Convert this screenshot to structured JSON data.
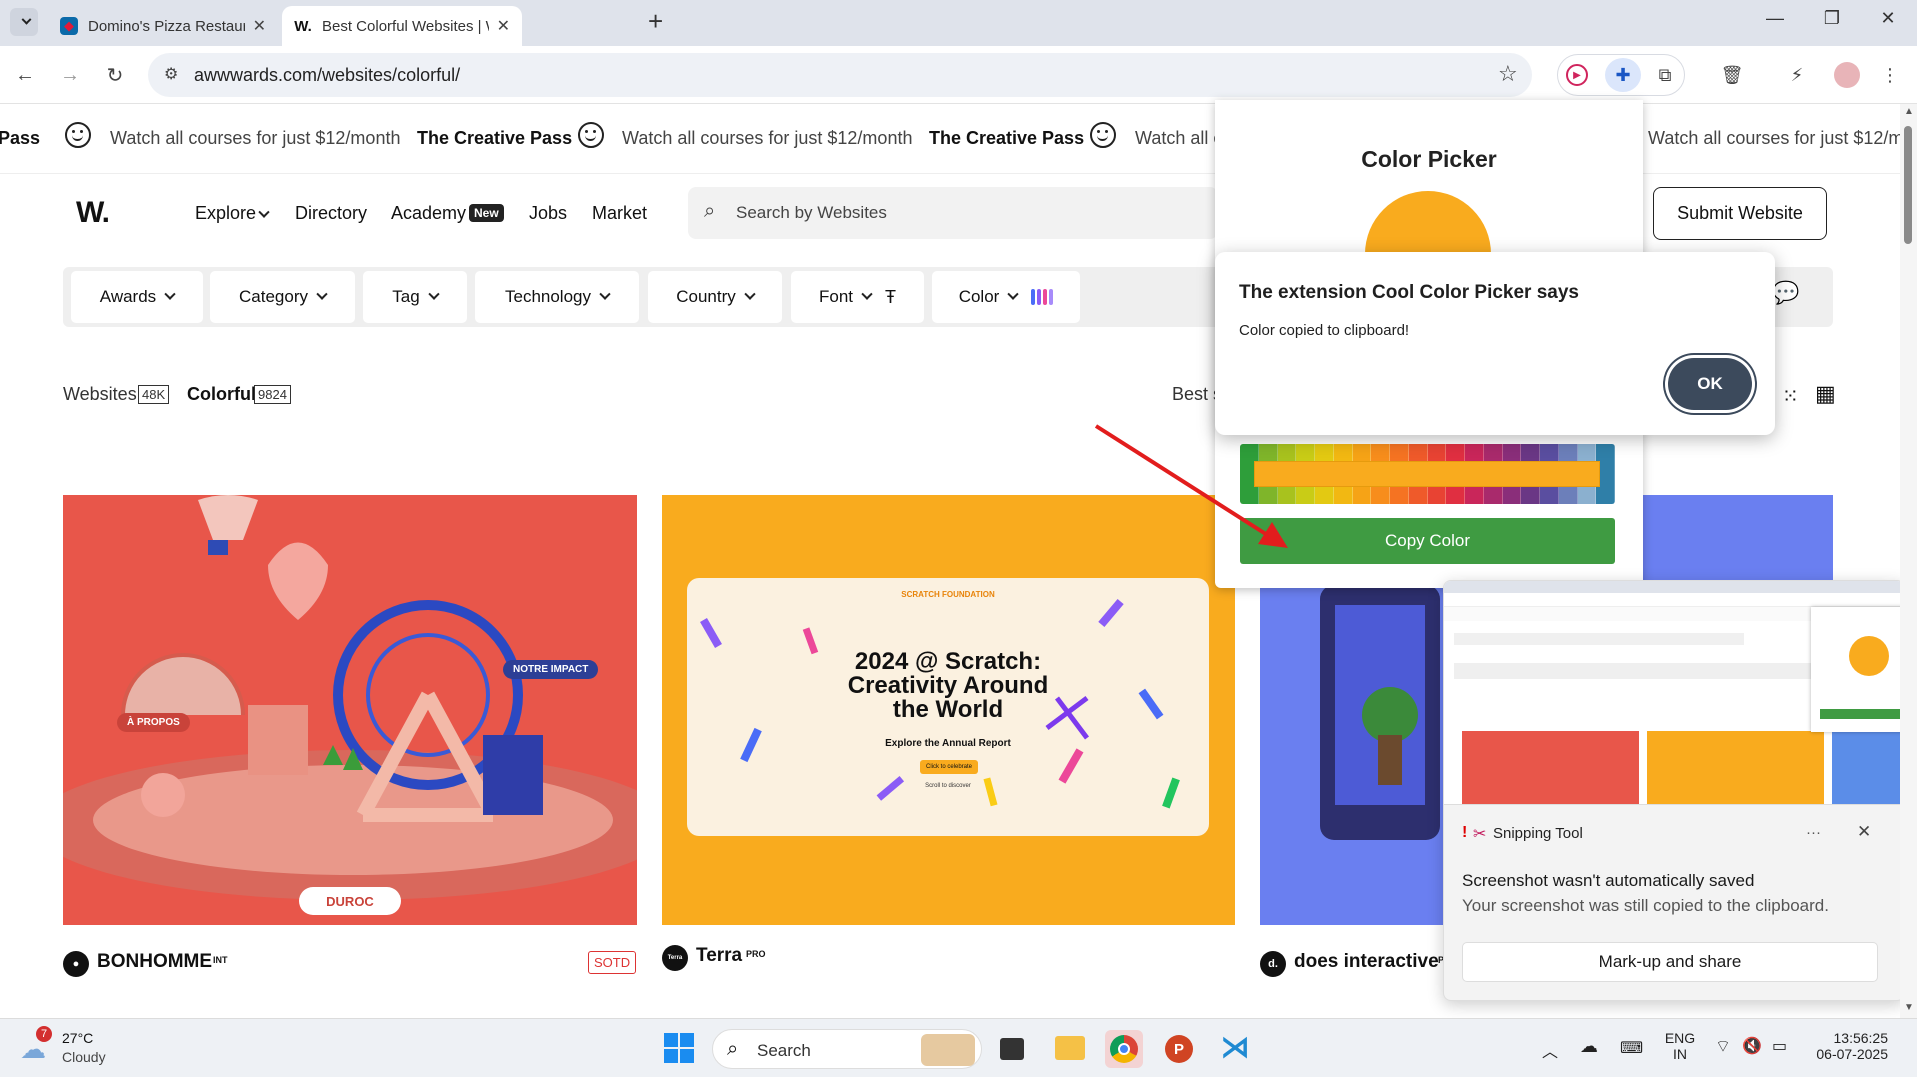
{
  "browser": {
    "tabs": [
      {
        "title": "Domino's Pizza Restaurant Near",
        "active": false
      },
      {
        "title": "Best Colorful Websites | Web De",
        "active": true
      }
    ],
    "new_tab": "+",
    "url": "awwwards.com/websites/colorful/"
  },
  "marquee": {
    "pass": "The Creative Pass",
    "pass_cut": "Pass",
    "offer": "Watch all courses for just $12/month",
    "offer_cut_right": "Watch all courses for just $12/mo",
    "offer_cut_mid": "Watch all c"
  },
  "site": {
    "logo": "W.",
    "nav": [
      "Explore",
      "Directory",
      "Academy",
      "Jobs",
      "Market"
    ],
    "new_badge": "New",
    "search_placeholder": "Search by Websites",
    "submit": "Submit Website"
  },
  "filters": [
    "Awards",
    "Category",
    "Tag",
    "Technology",
    "Country",
    "Font",
    "Color"
  ],
  "counts": {
    "websites_label": "Websites",
    "websites_count": "48K",
    "colorful_label": "Colorful",
    "colorful_count": "9824",
    "sort_cut": "Best s"
  },
  "cards": [
    {
      "name": "BONHOMME",
      "sup": "INT",
      "badge": "SOTD",
      "avatar": "●",
      "labels": [
        "À PROPOS",
        "NOTRE IMPACT"
      ],
      "pill": "DUROC"
    },
    {
      "name": "Terra",
      "sup": "PRO",
      "avatar": "Terra",
      "headline": "2024 @ Scratch: Creativity Around the World",
      "sub": "Explore the Annual Report",
      "brand": "SCRATCH FOUNDATION",
      "cta": "Click to celebrate",
      "hint": "Scroll to discover"
    },
    {
      "name": "does interactive",
      "sup": "PRO",
      "avatar": "d."
    }
  ],
  "color_picker": {
    "title": "Color Picker",
    "selected_color": "#f9ab1e",
    "copy_button": "Copy Color"
  },
  "alert": {
    "title": "The extension Cool Color Picker says",
    "message": "Color copied to clipboard!",
    "ok": "OK"
  },
  "snipping": {
    "app": "Snipping Tool",
    "heading": "Screenshot wasn't automatically saved",
    "sub": "Your screenshot was still copied to the clipboard.",
    "button": "Mark-up and share",
    "more": "···"
  },
  "taskbar": {
    "weather_temp": "27°C",
    "weather_desc": "Cloudy",
    "weather_badge": "7",
    "search": "Search",
    "lang1": "ENG",
    "lang2": "IN",
    "time": "13:56:25",
    "date": "06-07-2025"
  },
  "colors": {
    "accent_orange": "#f9ab1e",
    "card_red": "#e8564a",
    "copy_green": "#3f9b42",
    "ok_button": "#3c4a5c"
  }
}
